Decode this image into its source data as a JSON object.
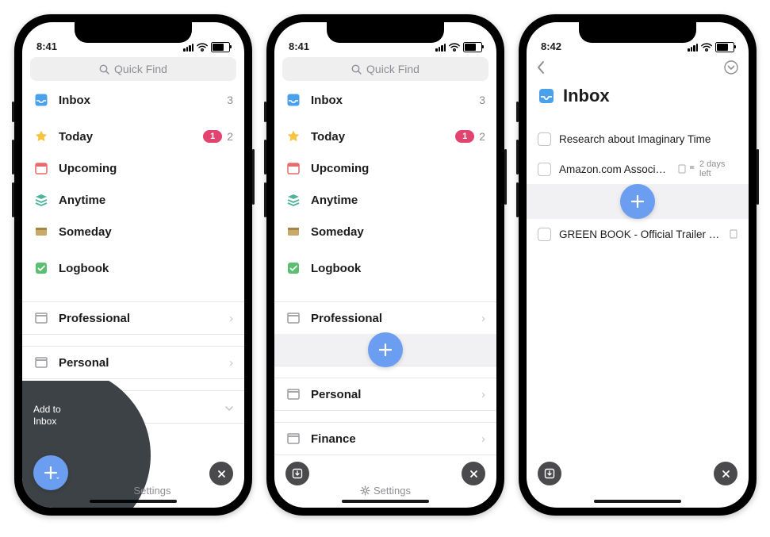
{
  "status": {
    "time_a": "8:41",
    "time_b": "8:42"
  },
  "search": {
    "placeholder": "Quick Find"
  },
  "nav": {
    "inbox": {
      "label": "Inbox",
      "count": "3"
    },
    "today": {
      "label": "Today",
      "badge": "1",
      "count": "2"
    },
    "upcoming": {
      "label": "Upcoming"
    },
    "anytime": {
      "label": "Anytime"
    },
    "someday": {
      "label": "Someday"
    },
    "logbook": {
      "label": "Logbook"
    }
  },
  "areas": {
    "professional": {
      "label": "Professional"
    },
    "personal": {
      "label": "Personal"
    },
    "finance": {
      "label": "Finance"
    }
  },
  "footer": {
    "settings": "Settings"
  },
  "phone1": {
    "add_to": "Add to",
    "inbox": "Inbox"
  },
  "phone3": {
    "title": "Inbox",
    "tasks": {
      "t1": {
        "title": "Research about Imaginary Time"
      },
      "t2": {
        "title": "Amazon.com Associat...",
        "due": "2 days left"
      },
      "t3": {
        "title": "GREEN BOOK - Official Trailer [HD..."
      }
    }
  }
}
